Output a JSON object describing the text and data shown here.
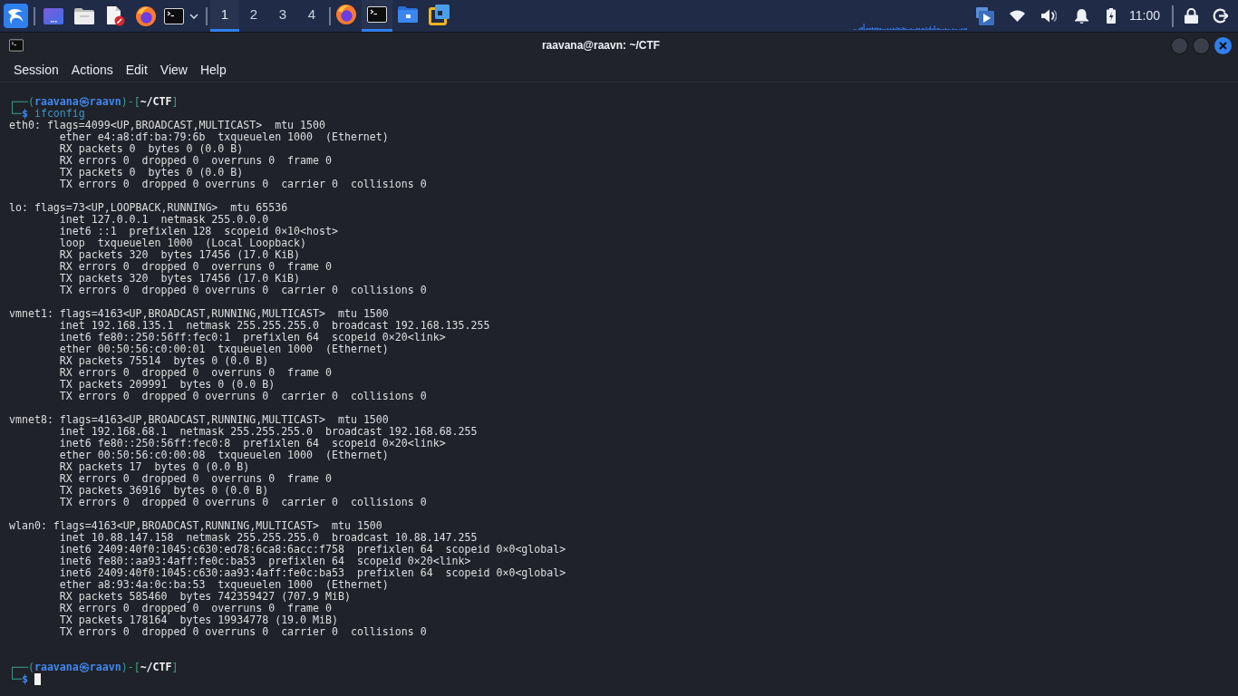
{
  "taskbar": {
    "workspaces": [
      {
        "label": "1",
        "selected": true
      },
      {
        "label": "2",
        "selected": false
      },
      {
        "label": "3",
        "selected": false
      },
      {
        "label": "4",
        "selected": false
      }
    ],
    "windows": [
      {
        "kind": "browser",
        "selected": false
      },
      {
        "kind": "terminal",
        "selected": true
      },
      {
        "kind": "files",
        "selected": false
      },
      {
        "kind": "vm",
        "selected": false
      }
    ],
    "clock": "11:00"
  },
  "window": {
    "title": "raavana@raavn: ~/CTF"
  },
  "menu": [
    "Session",
    "Actions",
    "Edit",
    "View",
    "Help"
  ],
  "terminal": {
    "session": [
      {
        "kind": "prompt",
        "frame_open": "┌──(",
        "identity": "raavana㉿raavn",
        "frame_mid": ")-[",
        "path": "~/CTF",
        "frame_close": "]",
        "corner": "└─",
        "symbol": "$",
        "command": "ifconfig",
        "cursor": false
      },
      {
        "kind": "output",
        "header": "eth0: flags=4099<UP,BROADCAST,MULTICAST>  mtu 1500",
        "details": [
          "ether e4:a8:df:ba:79:6b  txqueuelen 1000  (Ethernet)",
          "RX packets 0  bytes 0 (0.0 B)",
          "RX errors 0  dropped 0  overruns 0  frame 0",
          "TX packets 0  bytes 0 (0.0 B)",
          "TX errors 0  dropped 0 overruns 0  carrier 0  collisions 0"
        ]
      },
      {
        "kind": "output",
        "header": "lo: flags=73<UP,LOOPBACK,RUNNING>  mtu 65536",
        "details": [
          "inet 127.0.0.1  netmask 255.0.0.0",
          "inet6 ::1  prefixlen 128  scopeid 0×10<host>",
          "loop  txqueuelen 1000  (Local Loopback)",
          "RX packets 320  bytes 17456 (17.0 KiB)",
          "RX errors 0  dropped 0  overruns 0  frame 0",
          "TX packets 320  bytes 17456 (17.0 KiB)",
          "TX errors 0  dropped 0 overruns 0  carrier 0  collisions 0"
        ]
      },
      {
        "kind": "output",
        "header": "vmnet1: flags=4163<UP,BROADCAST,RUNNING,MULTICAST>  mtu 1500",
        "details": [
          "inet 192.168.135.1  netmask 255.255.255.0  broadcast 192.168.135.255",
          "inet6 fe80::250:56ff:fec0:1  prefixlen 64  scopeid 0×20<link>",
          "ether 00:50:56:c0:00:01  txqueuelen 1000  (Ethernet)",
          "RX packets 75514  bytes 0 (0.0 B)",
          "RX errors 0  dropped 0  overruns 0  frame 0",
          "TX packets 209991  bytes 0 (0.0 B)",
          "TX errors 0  dropped 0 overruns 0  carrier 0  collisions 0"
        ]
      },
      {
        "kind": "output",
        "header": "vmnet8: flags=4163<UP,BROADCAST,RUNNING,MULTICAST>  mtu 1500",
        "details": [
          "inet 192.168.68.1  netmask 255.255.255.0  broadcast 192.168.68.255",
          "inet6 fe80::250:56ff:fec0:8  prefixlen 64  scopeid 0×20<link>",
          "ether 00:50:56:c0:00:08  txqueuelen 1000  (Ethernet)",
          "RX packets 17  bytes 0 (0.0 B)",
          "RX errors 0  dropped 0  overruns 0  frame 0",
          "TX packets 36916  bytes 0 (0.0 B)",
          "TX errors 0  dropped 0 overruns 0  carrier 0  collisions 0"
        ]
      },
      {
        "kind": "output",
        "header": "wlan0: flags=4163<UP,BROADCAST,RUNNING,MULTICAST>  mtu 1500",
        "details": [
          "inet 10.88.147.158  netmask 255.255.255.0  broadcast 10.88.147.255",
          "inet6 2409:40f0:1045:c630:ed78:6ca8:6acc:f758  prefixlen 64  scopeid 0×0<global>",
          "inet6 fe80::aa93:4aff:fe0c:ba53  prefixlen 64  scopeid 0×20<link>",
          "inet6 2409:40f0:1045:c630:aa93:4aff:fe0c:ba53  prefixlen 64  scopeid 0×0<global>",
          "ether a8:93:4a:0c:ba:53  txqueuelen 1000  (Ethernet)",
          "RX packets 585460  bytes 742359427 (707.9 MiB)",
          "RX errors 0  dropped 0  overruns 0  frame 0",
          "TX packets 178164  bytes 19934778 (19.0 MiB)",
          "TX errors 0  dropped 0 overruns 0  carrier 0  collisions 0"
        ]
      },
      {
        "kind": "prompt",
        "frame_open": "┌──(",
        "identity": "raavana㉿raavn",
        "frame_mid": ")-[",
        "path": "~/CTF",
        "frame_close": "]",
        "corner": "└─",
        "symbol": "$",
        "cursor": true
      }
    ]
  }
}
